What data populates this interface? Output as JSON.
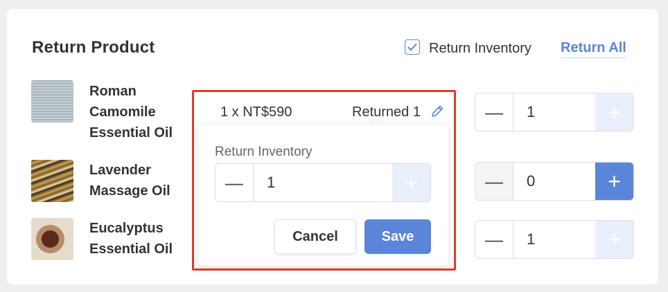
{
  "header": {
    "title": "Return Product",
    "return_inventory_label": "Return Inventory",
    "return_inventory_checked": true,
    "return_all_label": "Return All"
  },
  "products": [
    {
      "name": "Roman Camomile Essential Oil",
      "quantity": "1"
    },
    {
      "name": "Lavender Massage Oil",
      "quantity": "0"
    },
    {
      "name": "Eucalyptus Essential Oil",
      "quantity": "1"
    }
  ],
  "selected_item": {
    "price": "1 x NT$590",
    "returned": "Returned 1"
  },
  "popover": {
    "label": "Return Inventory",
    "value": "1",
    "cancel_label": "Cancel",
    "save_label": "Save"
  },
  "colors": {
    "accent": "#5a85d9",
    "highlight_border": "#e03a2b"
  },
  "icons": {
    "minus": "minus-icon",
    "plus": "plus-icon",
    "edit": "pencil-icon",
    "check": "checkmark-icon"
  }
}
